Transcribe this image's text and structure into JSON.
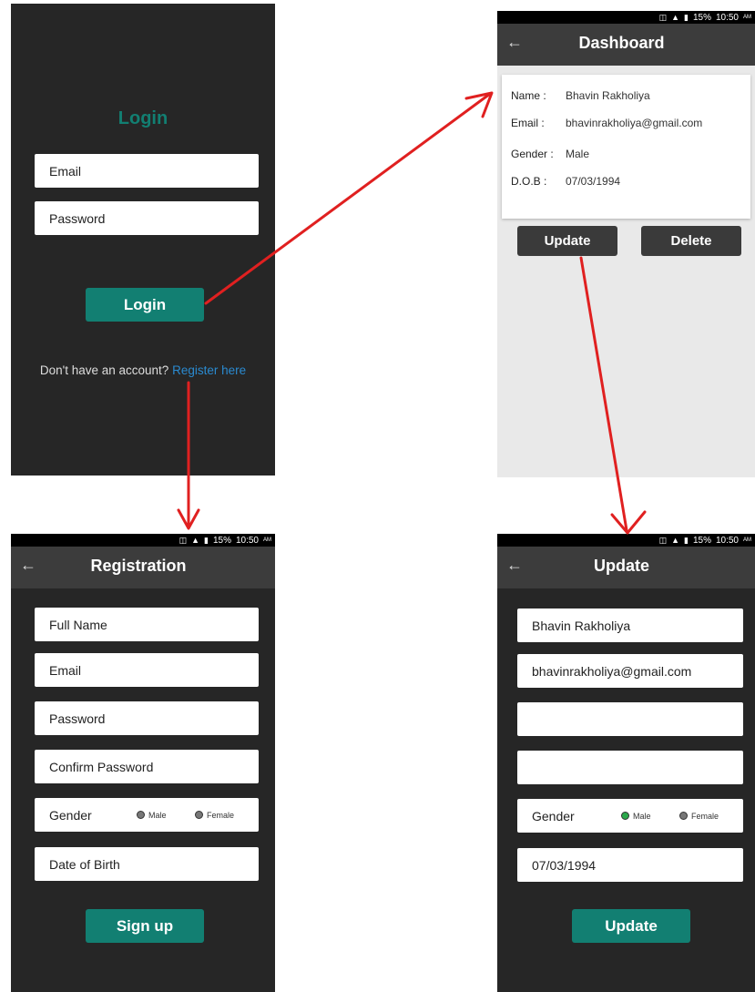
{
  "status_bar": {
    "battery": "15%",
    "time": "10:50",
    "ampm": "AM"
  },
  "login": {
    "title": "Login",
    "email_placeholder": "Email",
    "password_placeholder": "Password",
    "button": "Login",
    "prompt": "Don't have an account?",
    "register_link": "Register here"
  },
  "dashboard": {
    "title": "Dashboard",
    "fields": [
      {
        "label": "Name :",
        "value": "Bhavin Rakholiya"
      },
      {
        "label": "Email :",
        "value": "bhavinrakholiya@gmail.com"
      },
      {
        "label": "Gender :",
        "value": "Male"
      },
      {
        "label": "D.O.B :",
        "value": "07/03/1994"
      }
    ],
    "update_button": "Update",
    "delete_button": "Delete"
  },
  "registration": {
    "title": "Registration",
    "fullname_placeholder": "Full Name",
    "email_placeholder": "Email",
    "password_placeholder": "Password",
    "confirm_placeholder": "Confirm Password",
    "gender_label": "Gender",
    "male": "Male",
    "female": "Female",
    "dob_placeholder": "Date of Birth",
    "button": "Sign up"
  },
  "update": {
    "title": "Update",
    "name_value": "Bhavin Rakholiya",
    "email_value": "bhavinrakholiya@gmail.com",
    "gender_label": "Gender",
    "male": "Male",
    "female": "Female",
    "dob_value": "07/03/1994",
    "button": "Update"
  },
  "colors": {
    "accent": "#127f72",
    "link": "#2a8ad0",
    "arrow": "#e02020",
    "selected_radio": "#2aa84a"
  }
}
